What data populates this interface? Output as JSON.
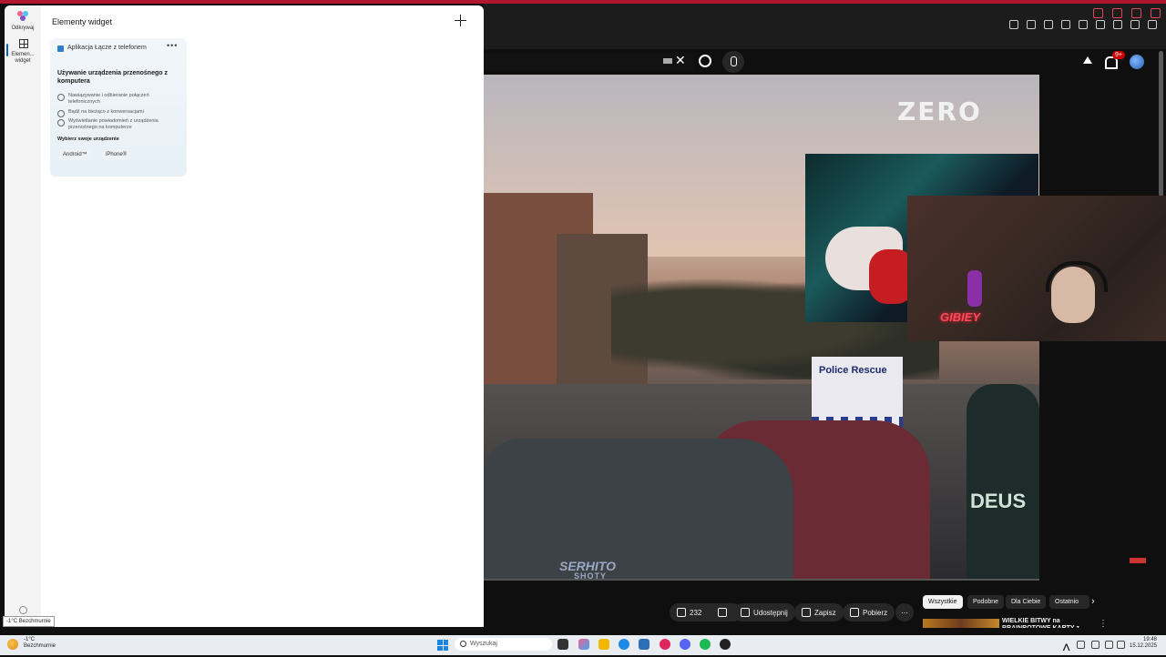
{
  "widgets_panel": {
    "title": "Elementy widget",
    "rail": {
      "discover_label": "Odkrywaj",
      "widgets_label_line1": "Elemen...",
      "widgets_label_line2": "widget"
    },
    "card": {
      "app_name": "Aplikacja Łącze z telefonem",
      "heading": "Używanie urządzenia przenośnego z komputera",
      "features": [
        "Nawiązywanie i odbieranie połączeń telefonicznych",
        "Bądź na bieżąco z konwersacjami",
        "Wyświetlanie powiadomień z urządzenia przenośnego na komputerze"
      ],
      "choose_label": "Wybierz swoje urządzenie",
      "devices": [
        "Android™",
        "iPhone®"
      ]
    }
  },
  "youtube": {
    "notifications_count": "9+",
    "video_watermarks": {
      "top_right": "ZERO",
      "bottom": "SERHITO",
      "bottom_sub": "SHOTY"
    },
    "video_overlay_text": {
      "van": "Police Rescue",
      "shirt": "DEUS",
      "neon": "GIBIEY"
    },
    "actions": {
      "like_count": "232",
      "share": "Udostępnij",
      "save": "Zapisz",
      "download": "Pobierz"
    },
    "chips": [
      "Wszystkie",
      "Podobne",
      "Dla Ciebie",
      "Ostatnio"
    ],
    "suggestion_title": "WIELKIE BITWY na BRAINROTOWE KARTY z"
  },
  "taskbar": {
    "weather_tooltip": "-1°C Bezchmurnie",
    "temp": "-1°C",
    "condition": "Bezchmurnie",
    "search_placeholder": "Wyszukaj",
    "time": "19:48",
    "date": "15.12.2025"
  },
  "colors": {
    "accent": "#0067c0",
    "youtube_red": "#cc0000",
    "browser_accent": "#b0162e"
  }
}
